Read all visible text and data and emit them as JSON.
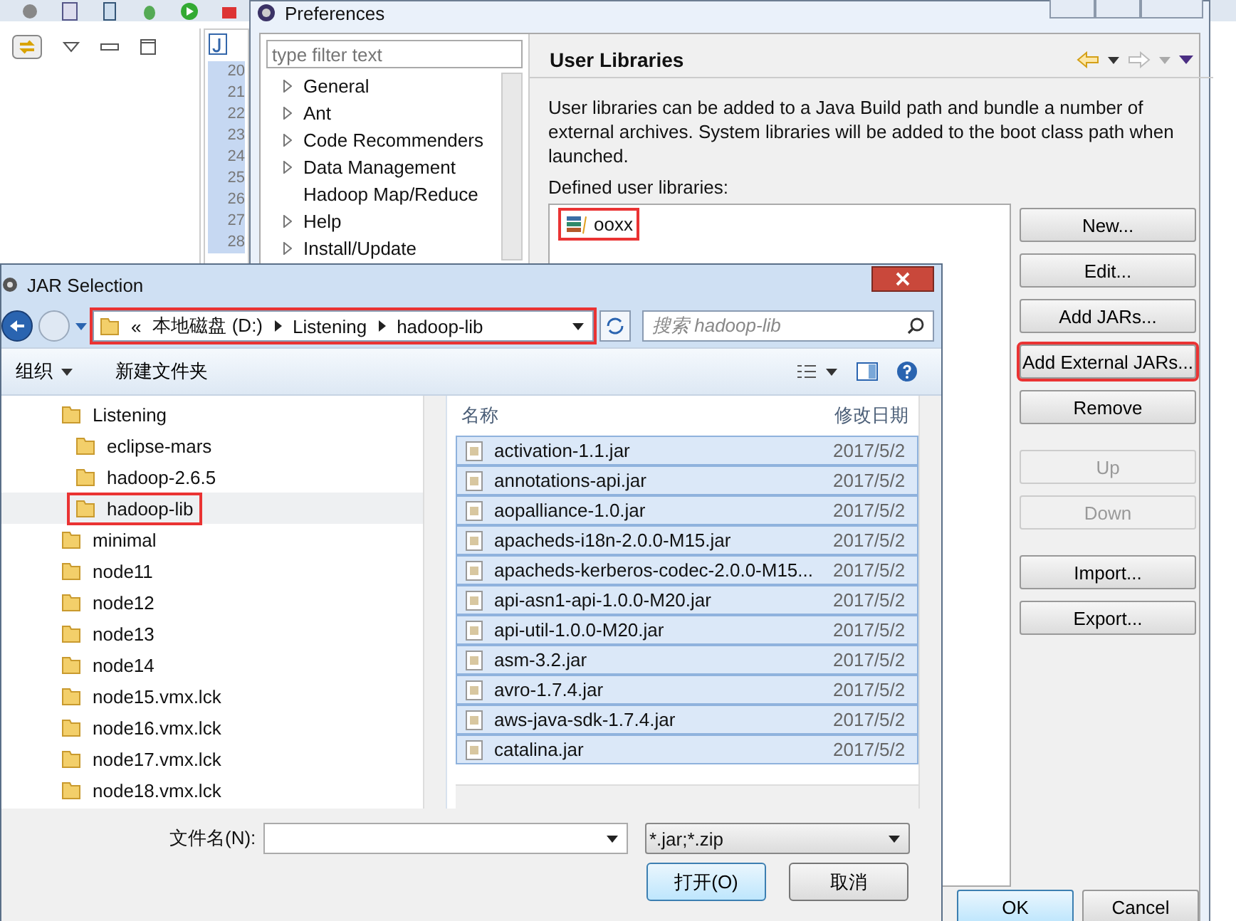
{
  "ide": {
    "line_numbers": [
      "20",
      "21",
      "22",
      "23",
      "24",
      "25",
      "26",
      "27",
      "28"
    ]
  },
  "preferences": {
    "title": "Preferences",
    "filter": {
      "placeholder": "type filter text"
    },
    "tree": [
      {
        "label": "General",
        "expandable": true
      },
      {
        "label": "Ant",
        "expandable": true
      },
      {
        "label": "Code Recommenders",
        "expandable": true
      },
      {
        "label": "Data Management",
        "expandable": true
      },
      {
        "label": "Hadoop Map/Reduce",
        "expandable": false
      },
      {
        "label": "Help",
        "expandable": true
      },
      {
        "label": "Install/Update",
        "expandable": true
      }
    ],
    "page": {
      "title": "User Libraries",
      "description": "User libraries can be added to a Java Build path and bundle a number of external archives. System libraries will be added to the boot class path when launched.",
      "list_label": "Defined user libraries:",
      "libraries": [
        {
          "name": "ooxx",
          "highlighted": true
        }
      ],
      "buttons": [
        {
          "label": "New...",
          "disabled": false,
          "highlighted": false
        },
        {
          "label": "Edit...",
          "disabled": false,
          "highlighted": false
        },
        {
          "label": "Add JARs...",
          "disabled": false,
          "highlighted": false
        },
        {
          "label": "Add External JARs...",
          "disabled": false,
          "highlighted": true
        },
        {
          "label": "Remove",
          "disabled": false,
          "highlighted": false
        },
        {
          "label": "Up",
          "disabled": true,
          "highlighted": false
        },
        {
          "label": "Down",
          "disabled": true,
          "highlighted": false
        },
        {
          "label": "Import...",
          "disabled": false,
          "highlighted": false
        },
        {
          "label": "Export...",
          "disabled": false,
          "highlighted": false
        }
      ]
    },
    "footer_buttons": [
      {
        "label": "OK",
        "default": true
      },
      {
        "label": "Cancel",
        "default": false
      }
    ]
  },
  "jar_selection": {
    "title": "JAR Selection",
    "address": {
      "overflow": "«",
      "segments": [
        "本地磁盘 (D:)",
        "Listening",
        "hadoop-lib"
      ],
      "highlighted": true
    },
    "search": {
      "placeholder": "搜索 hadoop-lib"
    },
    "toolbar": [
      {
        "label": "组织",
        "dropdown": true
      },
      {
        "label": "新建文件夹",
        "dropdown": false
      }
    ],
    "nav": [
      {
        "name": "Listening",
        "selected": false,
        "highlighted": false,
        "children": [
          {
            "name": "eclipse-mars",
            "selected": false,
            "highlighted": false
          },
          {
            "name": "hadoop-2.6.5",
            "selected": false,
            "highlighted": false
          },
          {
            "name": "hadoop-lib",
            "selected": true,
            "highlighted": true
          }
        ]
      },
      {
        "name": "minimal",
        "selected": false,
        "highlighted": false
      },
      {
        "name": "node11",
        "selected": false,
        "highlighted": false
      },
      {
        "name": "node12",
        "selected": false,
        "highlighted": false
      },
      {
        "name": "node13",
        "selected": false,
        "highlighted": false
      },
      {
        "name": "node14",
        "selected": false,
        "highlighted": false
      },
      {
        "name": "node15.vmx.lck",
        "selected": false,
        "highlighted": false
      },
      {
        "name": "node16.vmx.lck",
        "selected": false,
        "highlighted": false
      },
      {
        "name": "node17.vmx.lck",
        "selected": false,
        "highlighted": false
      },
      {
        "name": "node18.vmx.lck",
        "selected": false,
        "highlighted": false
      }
    ],
    "columns": [
      "名称",
      "修改日期"
    ],
    "files": [
      {
        "name": "activation-1.1.jar",
        "date": "2017/5/2",
        "selected": true
      },
      {
        "name": "annotations-api.jar",
        "date": "2017/5/2",
        "selected": true
      },
      {
        "name": "aopalliance-1.0.jar",
        "date": "2017/5/2",
        "selected": true
      },
      {
        "name": "apacheds-i18n-2.0.0-M15.jar",
        "date": "2017/5/2",
        "selected": true
      },
      {
        "name": "apacheds-kerberos-codec-2.0.0-M15...",
        "date": "2017/5/2",
        "selected": true
      },
      {
        "name": "api-asn1-api-1.0.0-M20.jar",
        "date": "2017/5/2",
        "selected": true
      },
      {
        "name": "api-util-1.0.0-M20.jar",
        "date": "2017/5/2",
        "selected": true
      },
      {
        "name": "asm-3.2.jar",
        "date": "2017/5/2",
        "selected": true
      },
      {
        "name": "avro-1.7.4.jar",
        "date": "2017/5/2",
        "selected": true
      },
      {
        "name": "aws-java-sdk-1.7.4.jar",
        "date": "2017/5/2",
        "selected": true
      },
      {
        "name": "catalina.jar",
        "date": "2017/5/2",
        "selected": true
      }
    ],
    "file_name": {
      "label": "文件名(N):"
    },
    "file_type": "*.jar;*.zip",
    "buttons": [
      {
        "label": "打开(O)",
        "default": true
      },
      {
        "label": "取消",
        "default": false
      }
    ]
  }
}
